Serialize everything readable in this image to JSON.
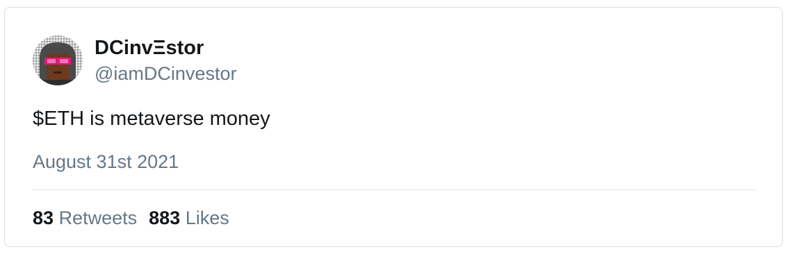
{
  "tweet": {
    "author": {
      "display_name": "DCinvΞstor",
      "handle": "@iamDCinvestor",
      "avatar_icon": "pixel-avatar-icon"
    },
    "text": "$ETH is metaverse money",
    "date": "August 31st 2021",
    "stats": {
      "retweets_count": "83",
      "retweets_label": "Retweets",
      "likes_count": "883",
      "likes_label": "Likes"
    }
  },
  "colors": {
    "primary_text": "#14171a",
    "secondary_text": "#657786",
    "border": "#d9dde1",
    "avatar_glasses": "#e0197d",
    "avatar_skin": "#6b3a1f"
  }
}
